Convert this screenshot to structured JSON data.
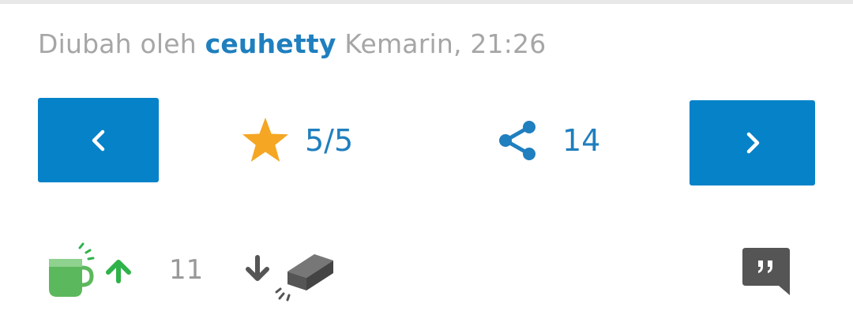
{
  "edited": {
    "prefix": "Diubah oleh",
    "user": "ceuhetty",
    "time": "Kemarin, 21:26"
  },
  "nav": {
    "prev_icon": "chevron-left-icon",
    "next_icon": "chevron-right-icon"
  },
  "rating": {
    "value": "5/5",
    "icon": "star-icon",
    "color": "#f5a623"
  },
  "share": {
    "count": "14",
    "icon": "share-icon"
  },
  "votes": {
    "up_count": "11",
    "up_icon": "cendol-upvote-icon",
    "down_icon": "bata-downvote-icon"
  },
  "comments": {
    "icon": "quote-comment-icon"
  },
  "colors": {
    "accent": "#0582c8",
    "link": "#1f7fbf",
    "muted": "#a6a6a6",
    "upvote_green": "#2fb24a",
    "cup_green": "#5cb85c",
    "dark_icon": "#555555"
  }
}
